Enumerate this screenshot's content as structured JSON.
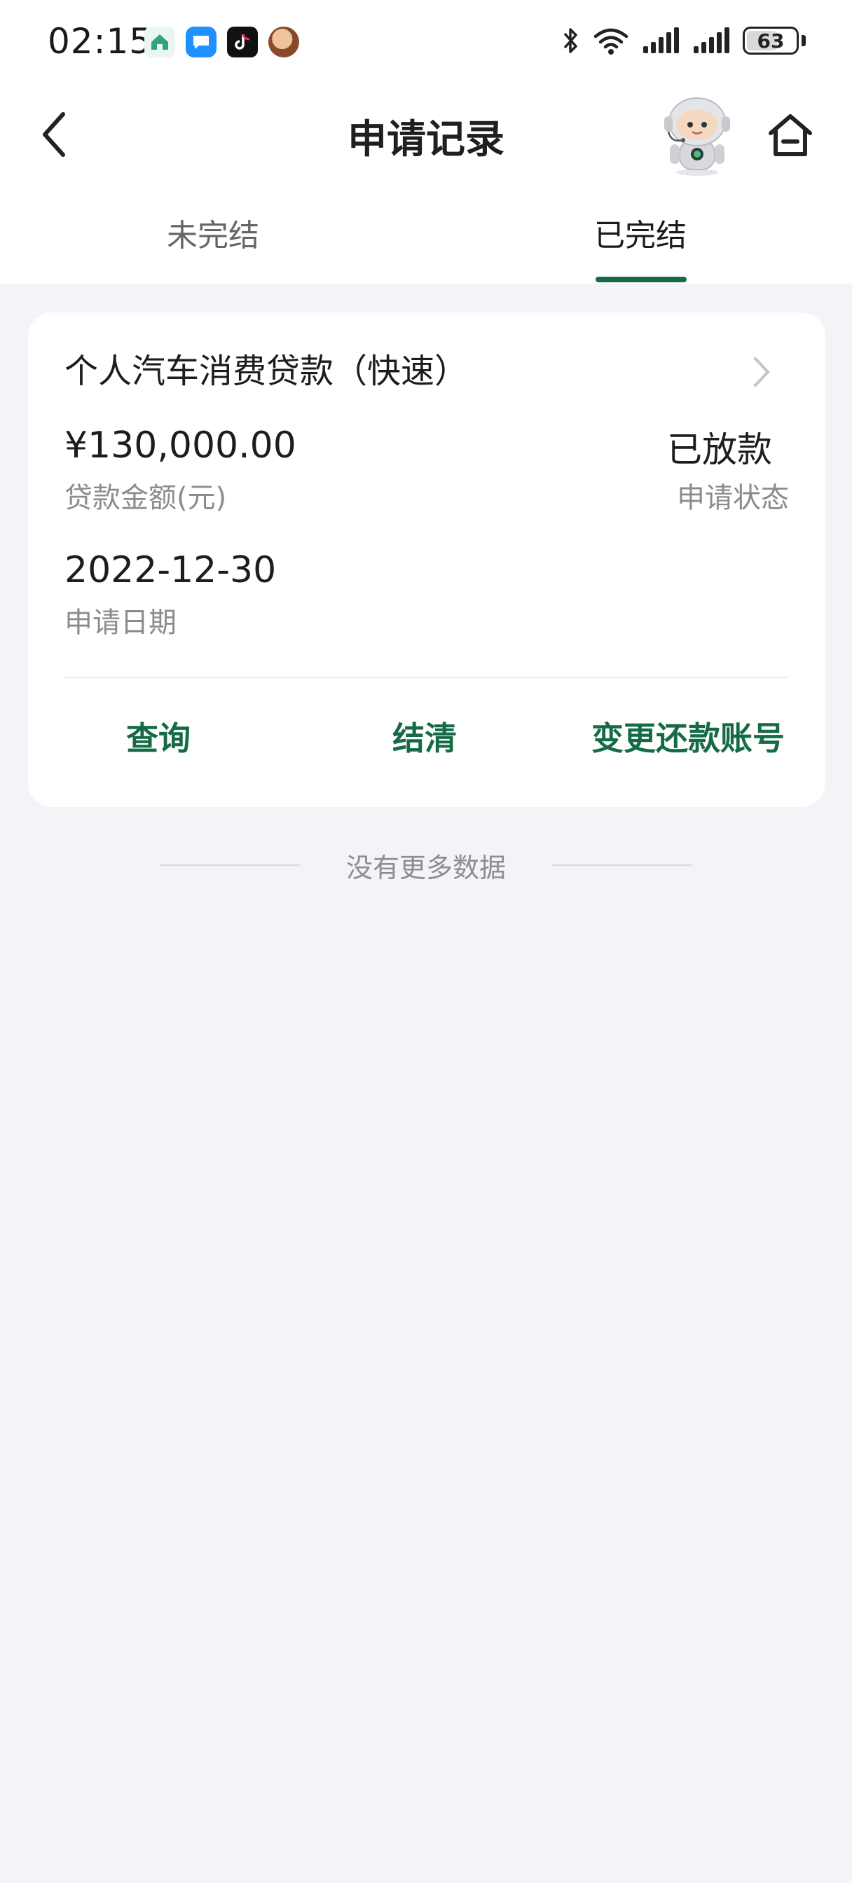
{
  "status_bar": {
    "time": "02:15",
    "battery_level": 63,
    "battery_label": "63",
    "icons": [
      "home-app-icon",
      "message-app-icon",
      "tiktok-icon",
      "avatar-app-icon",
      "bluetooth-icon",
      "wifi-icon",
      "signal-icon",
      "signal-icon",
      "battery-icon"
    ]
  },
  "header": {
    "title": "申请记录",
    "back_icon": "chevron-left-icon",
    "assistant_icon": "robot-assistant-icon",
    "home_icon": "home-icon"
  },
  "tabs": [
    {
      "label": "未完结",
      "active": false
    },
    {
      "label": "已完结",
      "active": true
    }
  ],
  "record": {
    "product_name": "个人汽车消费贷款（快速）",
    "amount": "¥130,000.00",
    "amount_label": "贷款金额(元)",
    "status": "已放款",
    "status_label": "申请状态",
    "date": "2022-12-30",
    "date_label": "申请日期",
    "actions": [
      "查询",
      "结清",
      "变更还款账号"
    ]
  },
  "footer": {
    "no_more": "没有更多数据"
  },
  "colors": {
    "accent": "#146b45",
    "background": "#f3f3f8",
    "card": "#ffffff"
  }
}
